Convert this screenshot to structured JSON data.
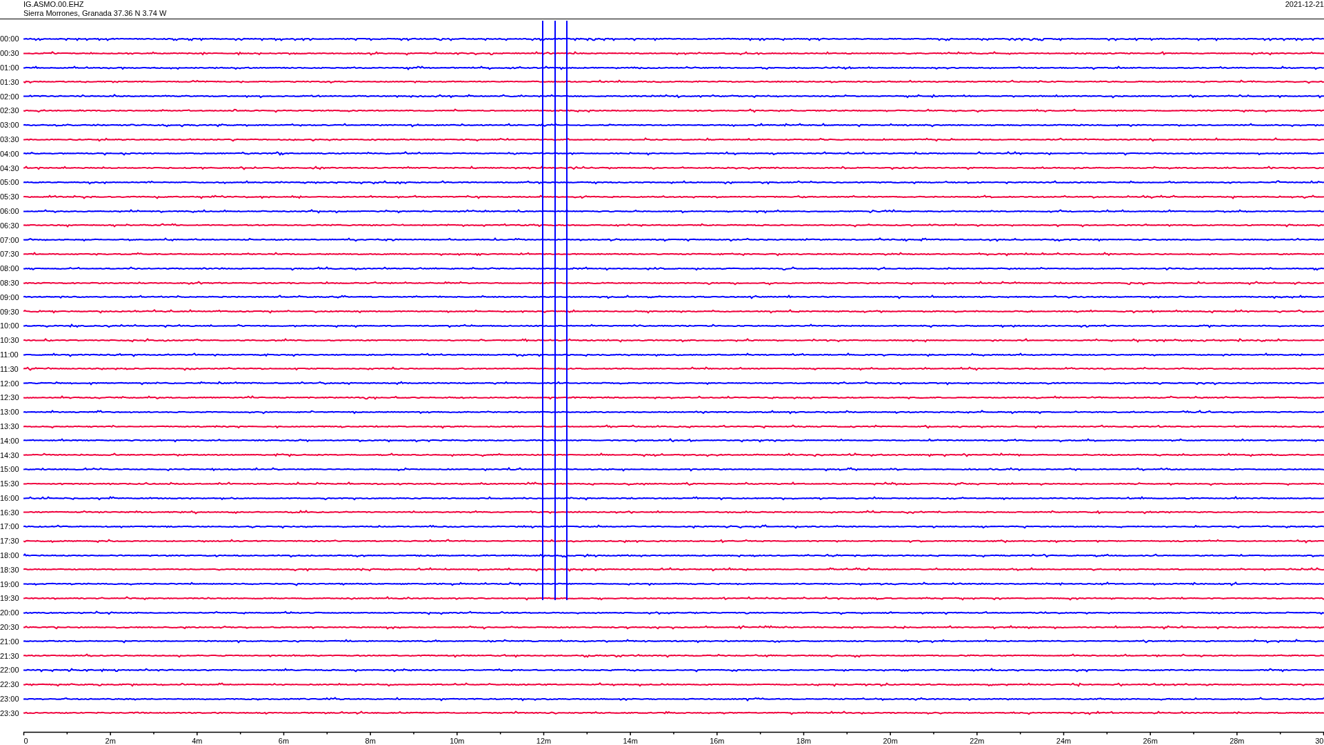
{
  "header": {
    "station": "IG.ASMO.00.EHZ",
    "location": "Sierra Morrones, Granada  37.36 N 3.74 W",
    "date": "2021-12-21"
  },
  "rows": [
    {
      "label": "00:00",
      "color": "#0000ff"
    },
    {
      "label": "00:30",
      "color": "#f0003c"
    },
    {
      "label": "01:00",
      "color": "#0000ff"
    },
    {
      "label": "01:30",
      "color": "#f0003c"
    },
    {
      "label": "02:00",
      "color": "#0000ff"
    },
    {
      "label": "02:30",
      "color": "#f0003c"
    },
    {
      "label": "03:00",
      "color": "#0000ff"
    },
    {
      "label": "03:30",
      "color": "#f0003c"
    },
    {
      "label": "04:00",
      "color": "#0000ff"
    },
    {
      "label": "04:30",
      "color": "#f0003c"
    },
    {
      "label": "05:00",
      "color": "#0000ff"
    },
    {
      "label": "05:30",
      "color": "#f0003c"
    },
    {
      "label": "06:00",
      "color": "#0000ff"
    },
    {
      "label": "06:30",
      "color": "#f0003c"
    },
    {
      "label": "07:00",
      "color": "#0000ff"
    },
    {
      "label": "07:30",
      "color": "#f0003c"
    },
    {
      "label": "08:00",
      "color": "#0000ff"
    },
    {
      "label": "08:30",
      "color": "#f0003c"
    },
    {
      "label": "09:00",
      "color": "#0000ff"
    },
    {
      "label": "09:30",
      "color": "#f0003c"
    },
    {
      "label": "10:00",
      "color": "#0000ff"
    },
    {
      "label": "10:30",
      "color": "#f0003c"
    },
    {
      "label": "11:00",
      "color": "#0000ff"
    },
    {
      "label": "11:30",
      "color": "#f0003c"
    },
    {
      "label": "12:00",
      "color": "#0000ff"
    },
    {
      "label": "12:30",
      "color": "#f0003c"
    },
    {
      "label": "13:00",
      "color": "#0000ff"
    },
    {
      "label": "13:30",
      "color": "#f0003c"
    },
    {
      "label": "14:00",
      "color": "#0000ff"
    },
    {
      "label": "14:30",
      "color": "#f0003c"
    },
    {
      "label": "15:00",
      "color": "#0000ff"
    },
    {
      "label": "15:30",
      "color": "#f0003c"
    },
    {
      "label": "16:00",
      "color": "#0000ff"
    },
    {
      "label": "16:30",
      "color": "#f0003c"
    },
    {
      "label": "17:00",
      "color": "#0000ff"
    },
    {
      "label": "17:30",
      "color": "#f0003c"
    },
    {
      "label": "18:00",
      "color": "#0000ff"
    },
    {
      "label": "18:30",
      "color": "#f0003c"
    },
    {
      "label": "19:00",
      "color": "#0000ff"
    },
    {
      "label": "19:30",
      "color": "#f0003c"
    },
    {
      "label": "20:00",
      "color": "#0000ff"
    },
    {
      "label": "20:30",
      "color": "#f0003c"
    },
    {
      "label": "21:00",
      "color": "#0000ff"
    },
    {
      "label": "21:30",
      "color": "#f0003c"
    },
    {
      "label": "22:00",
      "color": "#0000ff"
    },
    {
      "label": "22:30",
      "color": "#f0003c"
    },
    {
      "label": "23:00",
      "color": "#0000ff"
    },
    {
      "label": "23:30",
      "color": "#f0003c"
    }
  ],
  "x_axis_labels": [
    "0",
    "2m",
    "4m",
    "6m",
    "8m",
    "10m",
    "12m",
    "14m",
    "16m",
    "18m",
    "20m",
    "22m",
    "24m",
    "26m",
    "28m",
    "30"
  ]
}
